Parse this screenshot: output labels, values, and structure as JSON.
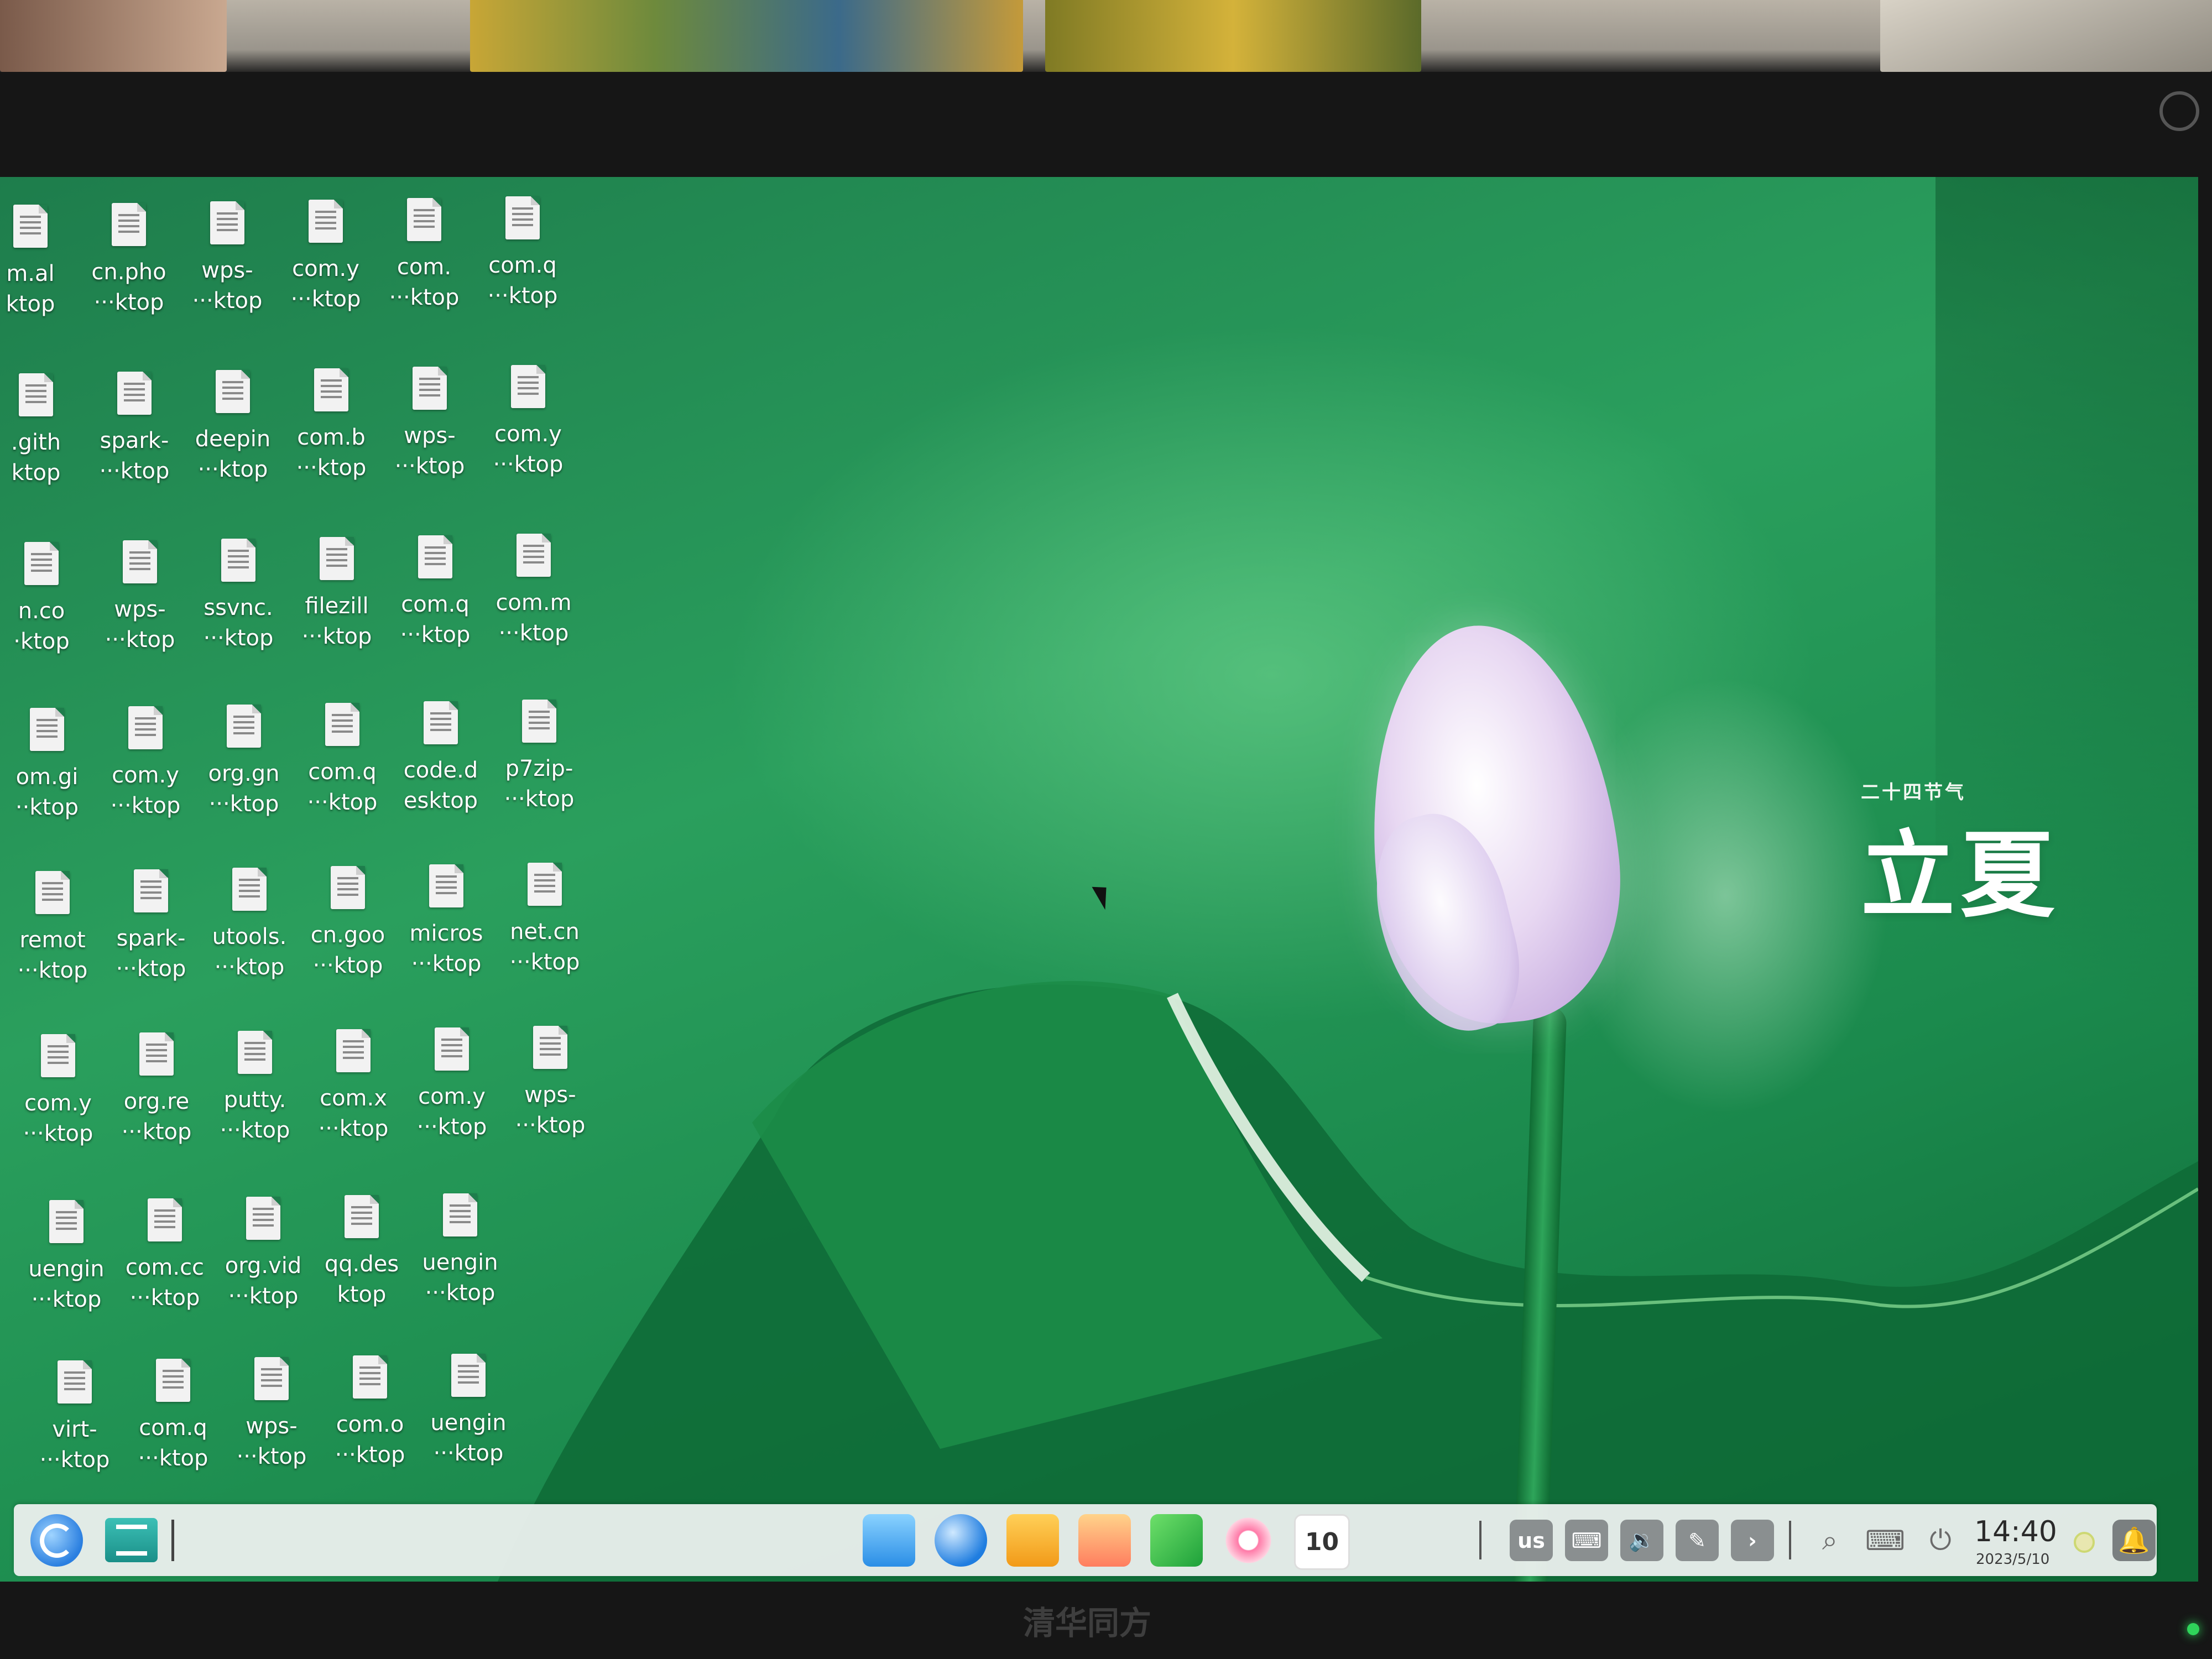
{
  "monitor": {
    "brand": "清华同方"
  },
  "wallpaper": {
    "solar_term_subtitle": "二十四节气",
    "solar_term_title": "立夏"
  },
  "desktop": {
    "icons": [
      {
        "line1": "m.al",
        "line2": "ktop"
      },
      {
        "line1": "cn.pho",
        "line2": "···ktop"
      },
      {
        "line1": "wps-",
        "line2": "···ktop"
      },
      {
        "line1": "com.y",
        "line2": "···ktop"
      },
      {
        "line1": "com.",
        "line2": "···ktop"
      },
      {
        "line1": "com.q",
        "line2": "···ktop"
      },
      {
        "line1": ".gith",
        "line2": "ktop"
      },
      {
        "line1": "spark-",
        "line2": "···ktop"
      },
      {
        "line1": "deepin",
        "line2": "···ktop"
      },
      {
        "line1": "com.b",
        "line2": "···ktop"
      },
      {
        "line1": "wps-",
        "line2": "···ktop"
      },
      {
        "line1": "com.y",
        "line2": "···ktop"
      },
      {
        "line1": "n.co",
        "line2": "·ktop"
      },
      {
        "line1": "wps-",
        "line2": "···ktop"
      },
      {
        "line1": "ssvnc.",
        "line2": "···ktop"
      },
      {
        "line1": "filezill",
        "line2": "···ktop"
      },
      {
        "line1": "com.q",
        "line2": "···ktop"
      },
      {
        "line1": "com.m",
        "line2": "···ktop"
      },
      {
        "line1": "om.gi",
        "line2": "··ktop"
      },
      {
        "line1": "com.y",
        "line2": "···ktop"
      },
      {
        "line1": "org.gn",
        "line2": "···ktop"
      },
      {
        "line1": "com.q",
        "line2": "···ktop"
      },
      {
        "line1": "code.d",
        "line2": "esktop"
      },
      {
        "line1": "p7zip-",
        "line2": "···ktop"
      },
      {
        "line1": "remot",
        "line2": "···ktop"
      },
      {
        "line1": "spark-",
        "line2": "···ktop"
      },
      {
        "line1": "utools.",
        "line2": "···ktop"
      },
      {
        "line1": "cn.goo",
        "line2": "···ktop"
      },
      {
        "line1": "micros",
        "line2": "···ktop"
      },
      {
        "line1": "net.cn",
        "line2": "···ktop"
      },
      {
        "line1": "com.y",
        "line2": "···ktop"
      },
      {
        "line1": "org.re",
        "line2": "···ktop"
      },
      {
        "line1": "putty.",
        "line2": "···ktop"
      },
      {
        "line1": "com.x",
        "line2": "···ktop"
      },
      {
        "line1": "com.y",
        "line2": "···ktop"
      },
      {
        "line1": "wps-",
        "line2": "···ktop"
      },
      {
        "line1": "uengin",
        "line2": "···ktop"
      },
      {
        "line1": "com.cc",
        "line2": "···ktop"
      },
      {
        "line1": "org.vid",
        "line2": "···ktop"
      },
      {
        "line1": "qq.des",
        "line2": "ktop"
      },
      {
        "line1": "uengin",
        "line2": "···ktop"
      },
      {
        "line1": "virt-",
        "line2": "···ktop"
      },
      {
        "line1": "com.q",
        "line2": "···ktop"
      },
      {
        "line1": "wps-",
        "line2": "···ktop"
      },
      {
        "line1": "com.o",
        "line2": "···ktop"
      },
      {
        "line1": "uengin",
        "line2": "···ktop"
      }
    ]
  },
  "taskbar": {
    "left_items": [
      "launcher-icon",
      "multitask-view-icon"
    ],
    "dock_apps": [
      "file-manager-icon",
      "browser-icon",
      "app-store-icon",
      "image-viewer-icon",
      "music-icon",
      "camera-icon",
      "calendar-icon"
    ],
    "calendar_day": "10",
    "tray": {
      "keyboard_layout": "us",
      "icons": [
        "keyboard-icon",
        "volume-icon",
        "pen-icon",
        "chevron-right-icon",
        "search-icon",
        "onscreen-keyboard-icon",
        "power-icon",
        "status-dot-icon",
        "bell-icon"
      ]
    },
    "clock": {
      "time": "14:40",
      "date": "2023/5/10"
    }
  },
  "colors": {
    "wallpaper_green": "#1e8a4d",
    "taskbar_bg": "#eceeed",
    "tray_button": "#8a8f90"
  }
}
